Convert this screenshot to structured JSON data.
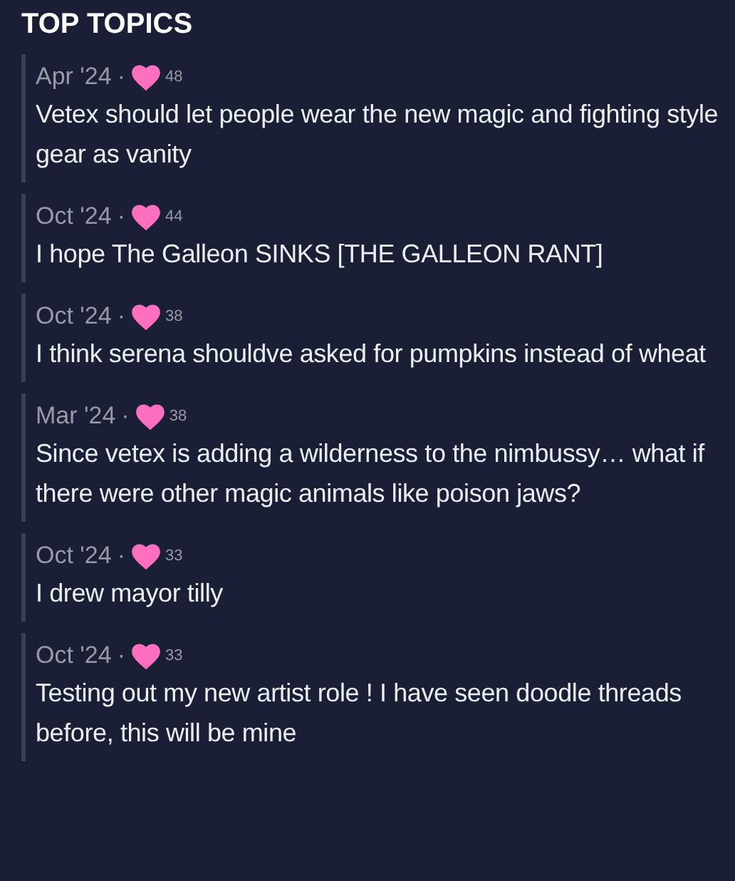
{
  "heading": "TOP TOPICS",
  "topics": [
    {
      "date": "Apr '24",
      "separator": "·",
      "likes": "48",
      "title": "Vetex should let people wear the new magic and fighting style gear as vanity"
    },
    {
      "date": "Oct '24",
      "separator": "·",
      "likes": "44",
      "title": "I hope The Galleon SINKS [THE GALLEON RANT]"
    },
    {
      "date": "Oct '24",
      "separator": "·",
      "likes": "38",
      "title": "I think serena shouldve asked for pumpkins instead of wheat"
    },
    {
      "date": "Mar '24",
      "separator": "·",
      "likes": "38",
      "title": "Since vetex is adding a wilderness to the nimbussy… what if there were other magic animals like poison jaws?"
    },
    {
      "date": "Oct '24",
      "separator": "·",
      "likes": "33",
      "title": "I drew mayor tilly"
    },
    {
      "date": "Oct '24",
      "separator": "·",
      "likes": "33",
      "title": "Testing out my new artist role ! I have seen doodle threads before, this will be mine"
    }
  ]
}
